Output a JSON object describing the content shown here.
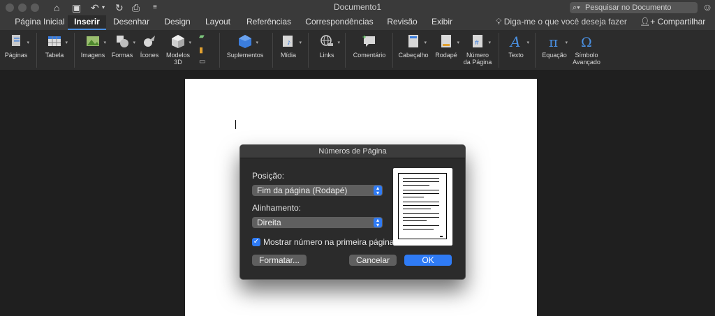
{
  "window": {
    "title": "Documento1",
    "search_placeholder": "Pesquisar no Documento"
  },
  "tabs": [
    {
      "label": "Página Inicial"
    },
    {
      "label": "Inserir"
    },
    {
      "label": "Desenhar"
    },
    {
      "label": "Design"
    },
    {
      "label": "Layout"
    },
    {
      "label": "Referências"
    },
    {
      "label": "Correspondências"
    },
    {
      "label": "Revisão"
    },
    {
      "label": "Exibir"
    }
  ],
  "tell_me": "Diga-me o que você deseja fazer",
  "share_label": "Compartilhar",
  "ribbon": {
    "paginas": "Páginas",
    "tabela": "Tabela",
    "imagens": "Imagens",
    "formas": "Formas",
    "icones": "Ícones",
    "modelos3d_l1": "Modelos",
    "modelos3d_l2": "3D",
    "suplementos": "Suplementos",
    "midia": "Mídia",
    "links": "Links",
    "comentario": "Comentário",
    "cabecalho": "Cabeçalho",
    "rodape": "Rodapé",
    "numero_l1": "Número",
    "numero_l2": "da Página",
    "texto": "Texto",
    "equacao": "Equação",
    "simbolo_l1": "Símbolo",
    "simbolo_l2": "Avançado"
  },
  "dialog": {
    "title": "Números de Página",
    "position_label": "Posição:",
    "position_value": "Fim da página (Rodapé)",
    "alignment_label": "Alinhamento:",
    "alignment_value": "Direita",
    "show_first_label": "Mostrar número na primeira página",
    "show_first_checked": true,
    "format_button": "Formatar...",
    "cancel_button": "Cancelar",
    "ok_button": "OK"
  },
  "colors": {
    "accent": "#2f7bf5",
    "ribbon_bg": "#2c2c2c",
    "titlebar_bg": "#3a3a3a"
  }
}
